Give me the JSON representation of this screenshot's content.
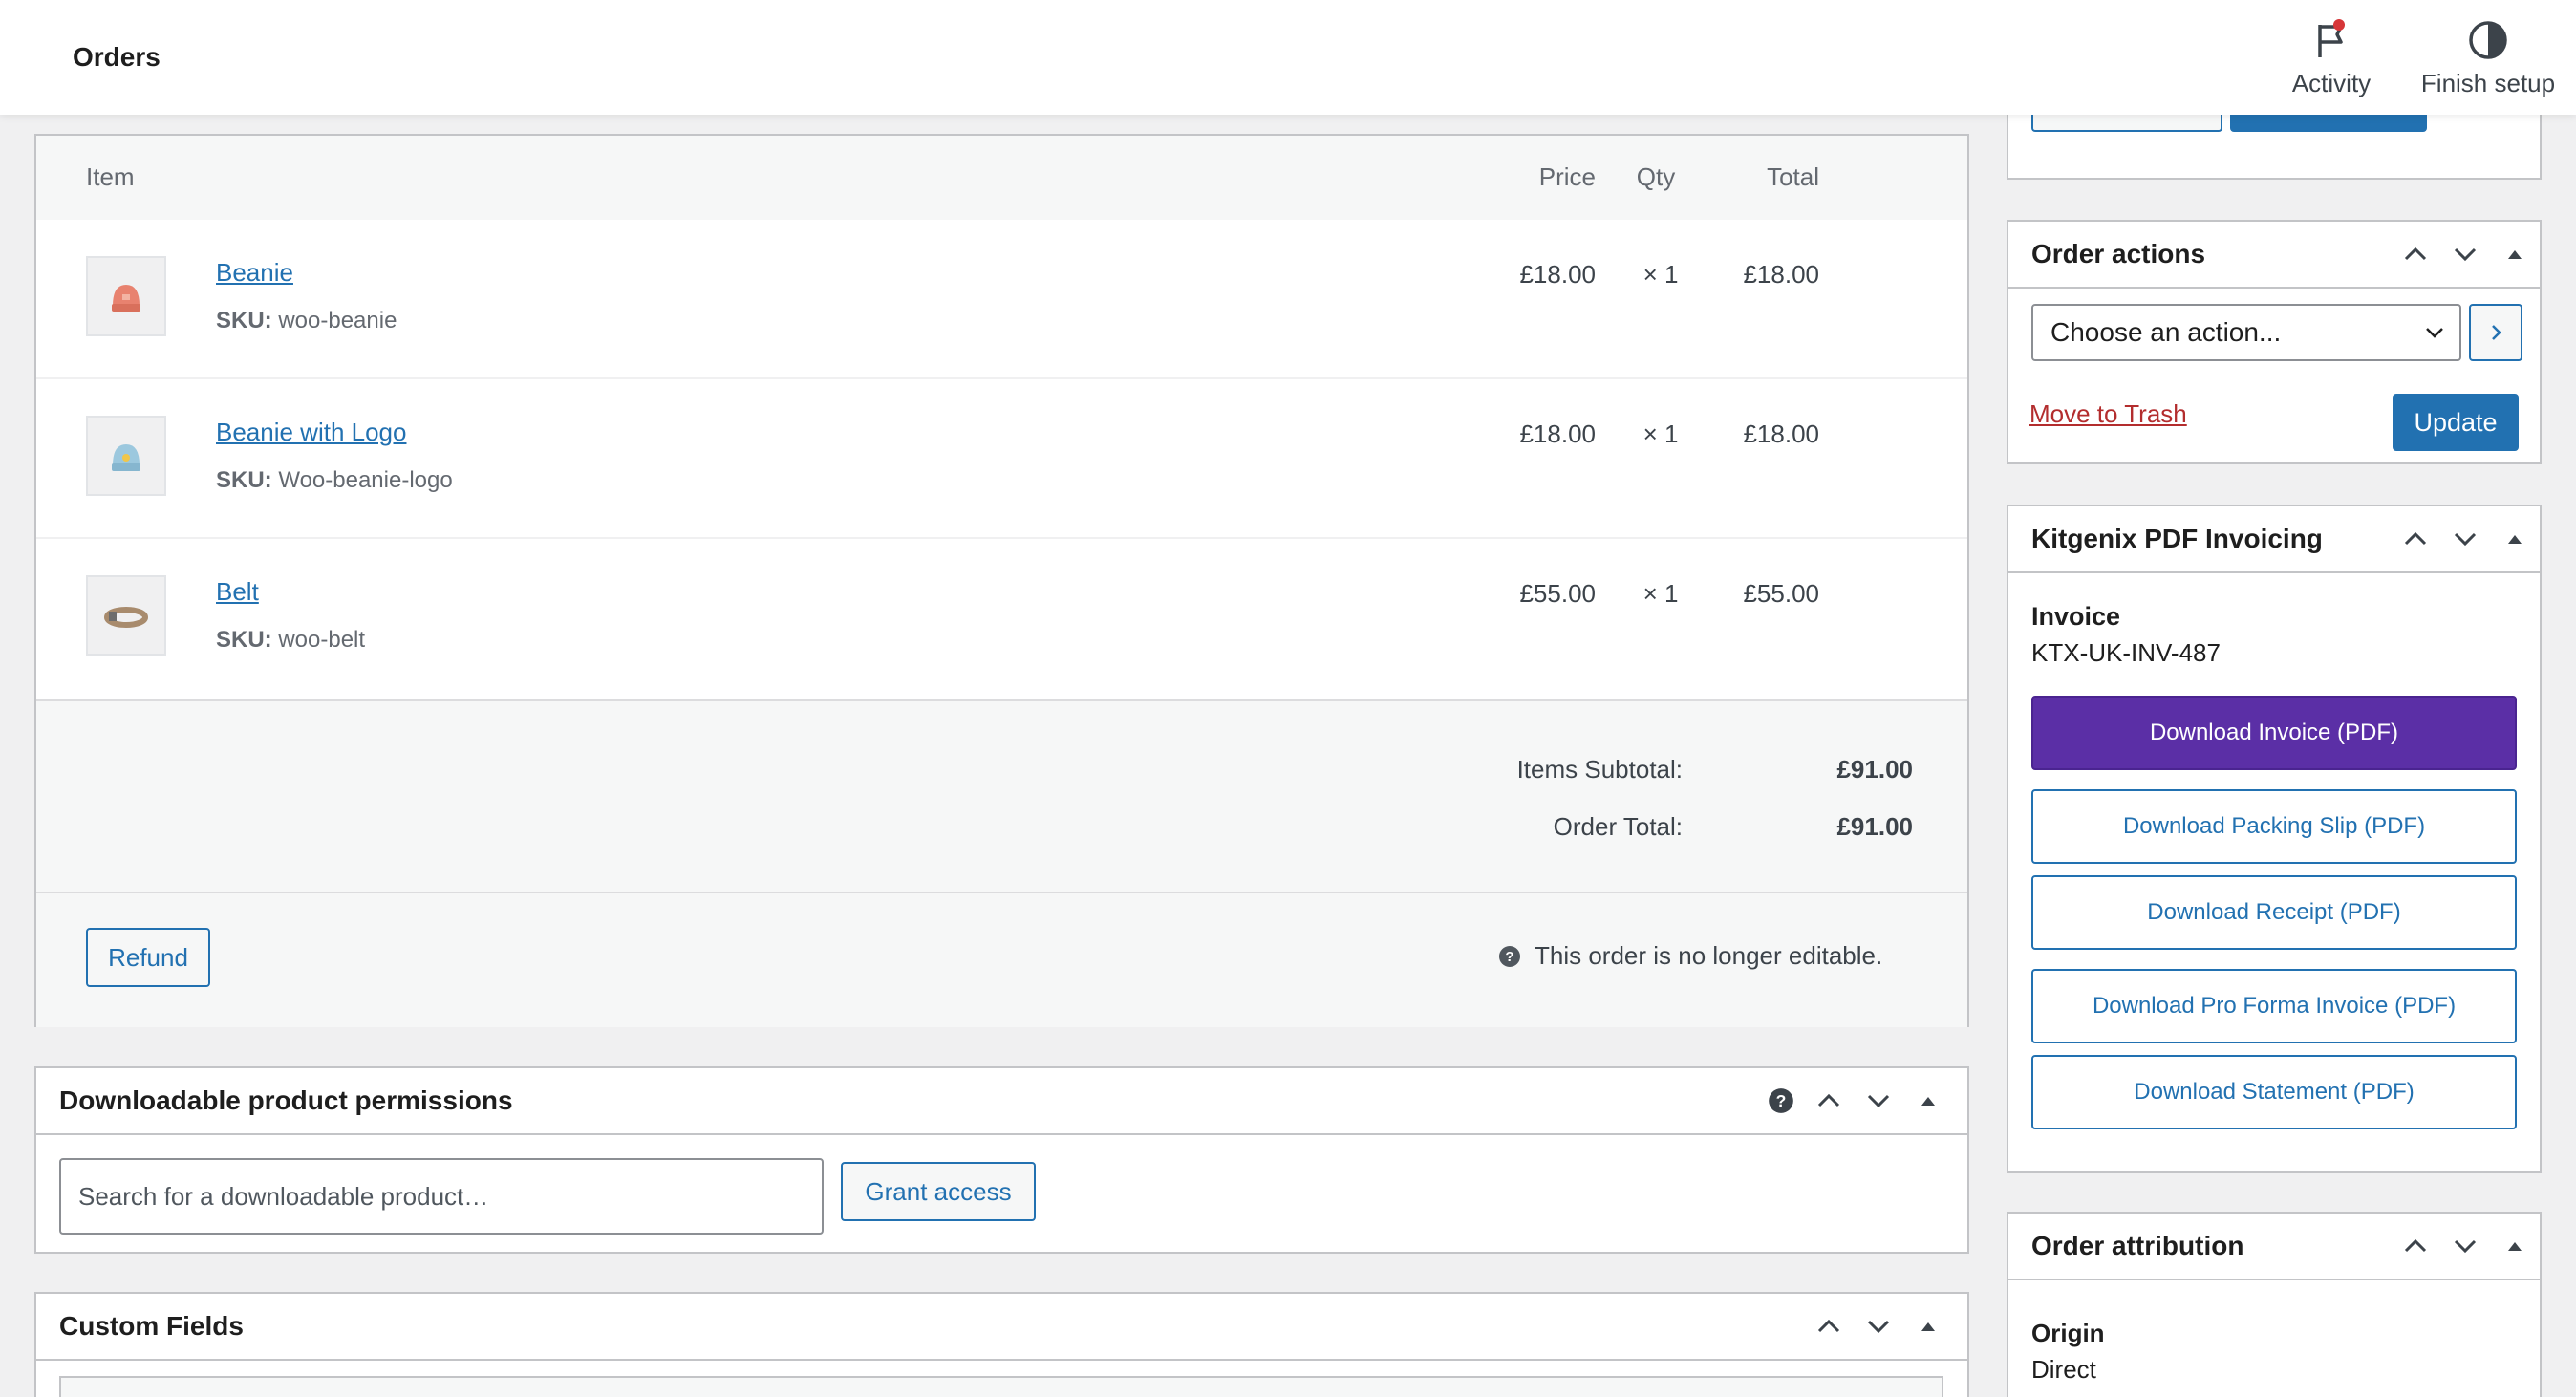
{
  "header": {
    "title": "Orders",
    "activity_label": "Activity",
    "finish_setup_label": "Finish setup"
  },
  "items_table": {
    "col_item": "Item",
    "col_price": "Price",
    "col_qty": "Qty",
    "col_total": "Total",
    "sku_label": "SKU:",
    "rows": [
      {
        "name": "Beanie",
        "sku": "woo-beanie",
        "price": "£18.00",
        "qty": "× 1",
        "total": "£18.00"
      },
      {
        "name": "Beanie with Logo",
        "sku": "Woo-beanie-logo",
        "price": "£18.00",
        "qty": "× 1",
        "total": "£18.00"
      },
      {
        "name": "Belt",
        "sku": "woo-belt",
        "price": "£55.00",
        "qty": "× 1",
        "total": "£55.00"
      }
    ],
    "items_subtotal_label": "Items Subtotal:",
    "items_subtotal_value": "£91.00",
    "order_total_label": "Order Total:",
    "order_total_value": "£91.00",
    "refund_label": "Refund",
    "not_editable_text": "This order is no longer editable."
  },
  "downloadable": {
    "title": "Downloadable product permissions",
    "search_placeholder": "Search for a downloadable product…",
    "grant_label": "Grant access"
  },
  "custom_fields": {
    "title": "Custom Fields"
  },
  "order_actions": {
    "title": "Order actions",
    "select_value": "Choose an action...",
    "trash_label": "Move to Trash",
    "update_label": "Update"
  },
  "pdf_invoicing": {
    "title": "Kitgenix PDF Invoicing",
    "invoice_label": "Invoice",
    "invoice_number": "KTX-UK-INV-487",
    "buttons": [
      "Download Invoice (PDF)",
      "Download Packing Slip (PDF)",
      "Download Receipt (PDF)",
      "Download Pro Forma Invoice (PDF)",
      "Download Statement (PDF)"
    ],
    "primary_color": "#5b2fa6"
  },
  "order_attribution": {
    "title": "Order attribution",
    "origin_label": "Origin",
    "origin_value": "Direct"
  },
  "colors": {
    "accent": "#2271b1",
    "danger": "#b32d2e",
    "notification": "#d63638"
  }
}
